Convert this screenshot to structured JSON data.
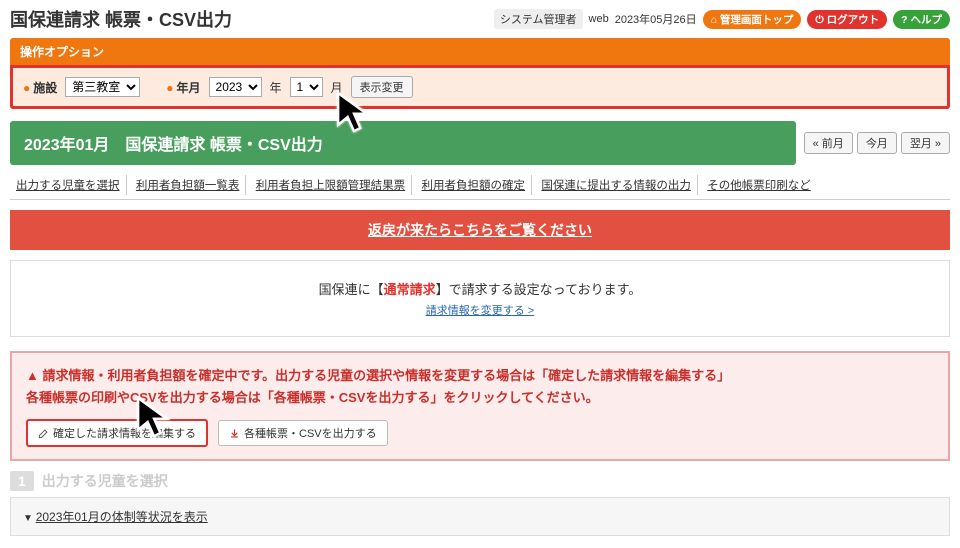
{
  "header": {
    "title": "国保連請求 帳票・CSV出力",
    "user_role": "システム管理者",
    "user_name": "web",
    "date": "2023年05月26日",
    "btn_admin": "管理画面トップ",
    "btn_logout": "ログアウト",
    "btn_help": "ヘルプ"
  },
  "options": {
    "panel_title": "操作オプション",
    "label_facility": "施設",
    "facility_value": "第三教室",
    "label_ym": "年月",
    "year_value": "2023",
    "year_suffix": "年",
    "month_value": "1",
    "month_suffix": "月",
    "btn_apply": "表示変更"
  },
  "greenbar": {
    "title": "2023年01月　国保連請求 帳票・CSV出力",
    "btn_prev": "« 前月",
    "btn_this": "今月",
    "btn_next": "翌月 »"
  },
  "tabs": [
    "出力する児童を選択",
    "利用者負担額一覧表",
    "利用者負担上限額管理結果票",
    "利用者負担額の確定",
    "国保連に提出する情報の出力",
    "その他帳票印刷など"
  ],
  "banner": "返戻が来たらこちらをご覧ください",
  "notice": {
    "pre": "国保連に【",
    "em": "通常請求",
    "post": "】で請求する設定なっております。",
    "link": "請求情報を変更する >"
  },
  "warn": {
    "line1": "▲ 請求情報・利用者負担額を確定中です。出力する児童の選択や情報を変更する場合は「確定した請求情報を編集する」",
    "line2": "各種帳票の印刷やCSVを出力する場合は「各種帳票・CSVを出力する」をクリックしてください。",
    "btn_edit": "確定した請求情報を編集する",
    "btn_output": "各種帳票・CSVを出力する"
  },
  "step": {
    "num": "1",
    "label": "出力する児童を選択"
  },
  "accordion": {
    "label": "2023年01月の体制等状況を表示"
  }
}
